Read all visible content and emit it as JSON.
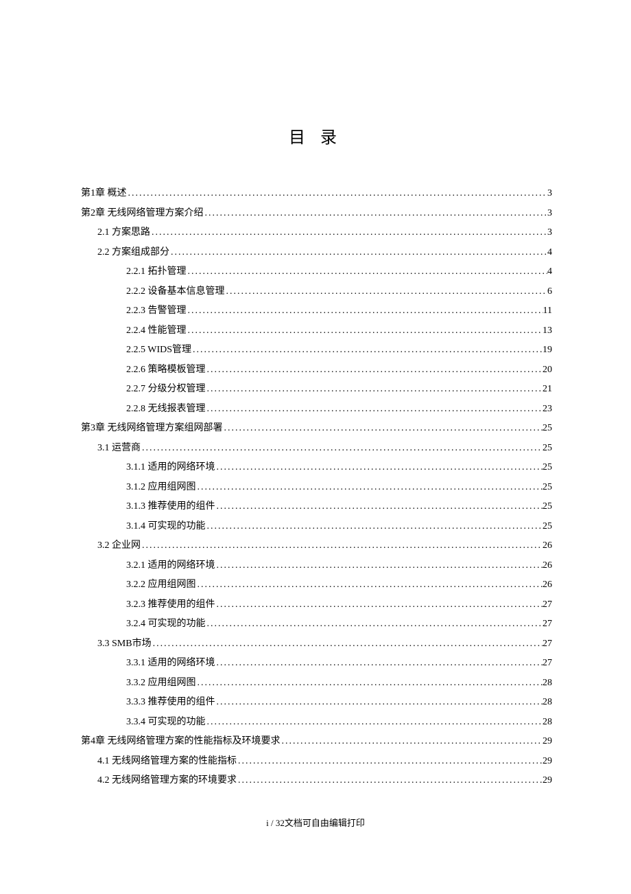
{
  "title": "目 录",
  "footer": "i / 32文档可自由编辑打印",
  "toc": [
    {
      "level": 0,
      "label": "第1章 概述",
      "page": "3"
    },
    {
      "level": 0,
      "label": "第2章 无线网络管理方案介绍",
      "page": "3"
    },
    {
      "level": 1,
      "label": "2.1 方案思路",
      "page": "3"
    },
    {
      "level": 1,
      "label": "2.2 方案组成部分",
      "page": "4"
    },
    {
      "level": 2,
      "label": "2.2.1 拓扑管理",
      "page": "4"
    },
    {
      "level": 2,
      "label": "2.2.2 设备基本信息管理",
      "page": "6"
    },
    {
      "level": 2,
      "label": "2.2.3 告警管理",
      "page": "11"
    },
    {
      "level": 2,
      "label": "2.2.4 性能管理",
      "page": "13"
    },
    {
      "level": 2,
      "label": "2.2.5 WIDS管理",
      "page": "19"
    },
    {
      "level": 2,
      "label": "2.2.6 策略模板管理",
      "page": "20"
    },
    {
      "level": 2,
      "label": "2.2.7 分级分权管理",
      "page": "21"
    },
    {
      "level": 2,
      "label": "2.2.8 无线报表管理",
      "page": "23"
    },
    {
      "level": 0,
      "label": "第3章 无线网络管理方案组网部署",
      "page": "25"
    },
    {
      "level": 1,
      "label": "3.1 运营商",
      "page": "25"
    },
    {
      "level": 2,
      "label": "3.1.1 适用的网络环境",
      "page": "25"
    },
    {
      "level": 2,
      "label": "3.1.2 应用组网图",
      "page": "25"
    },
    {
      "level": 2,
      "label": "3.1.3 推荐使用的组件",
      "page": "25"
    },
    {
      "level": 2,
      "label": "3.1.4 可实现的功能",
      "page": "25"
    },
    {
      "level": 1,
      "label": "3.2 企业网",
      "page": "26"
    },
    {
      "level": 2,
      "label": "3.2.1 适用的网络环境",
      "page": "26"
    },
    {
      "level": 2,
      "label": "3.2.2 应用组网图",
      "page": "26"
    },
    {
      "level": 2,
      "label": "3.2.3 推荐使用的组件",
      "page": "27"
    },
    {
      "level": 2,
      "label": "3.2.4 可实现的功能",
      "page": "27"
    },
    {
      "level": 1,
      "label": "3.3 SMB市场",
      "page": "27"
    },
    {
      "level": 2,
      "label": "3.3.1 适用的网络环境",
      "page": "27"
    },
    {
      "level": 2,
      "label": "3.3.2 应用组网图",
      "page": "28"
    },
    {
      "level": 2,
      "label": "3.3.3 推荐使用的组件",
      "page": "28"
    },
    {
      "level": 2,
      "label": "3.3.4 可实现的功能",
      "page": "28"
    },
    {
      "level": 0,
      "label": "第4章 无线网络管理方案的性能指标及环境要求",
      "page": "29"
    },
    {
      "level": 1,
      "label": "4.1 无线网络管理方案的性能指标",
      "page": "29"
    },
    {
      "level": 1,
      "label": "4.2 无线网络管理方案的环境要求",
      "page": "29"
    }
  ]
}
